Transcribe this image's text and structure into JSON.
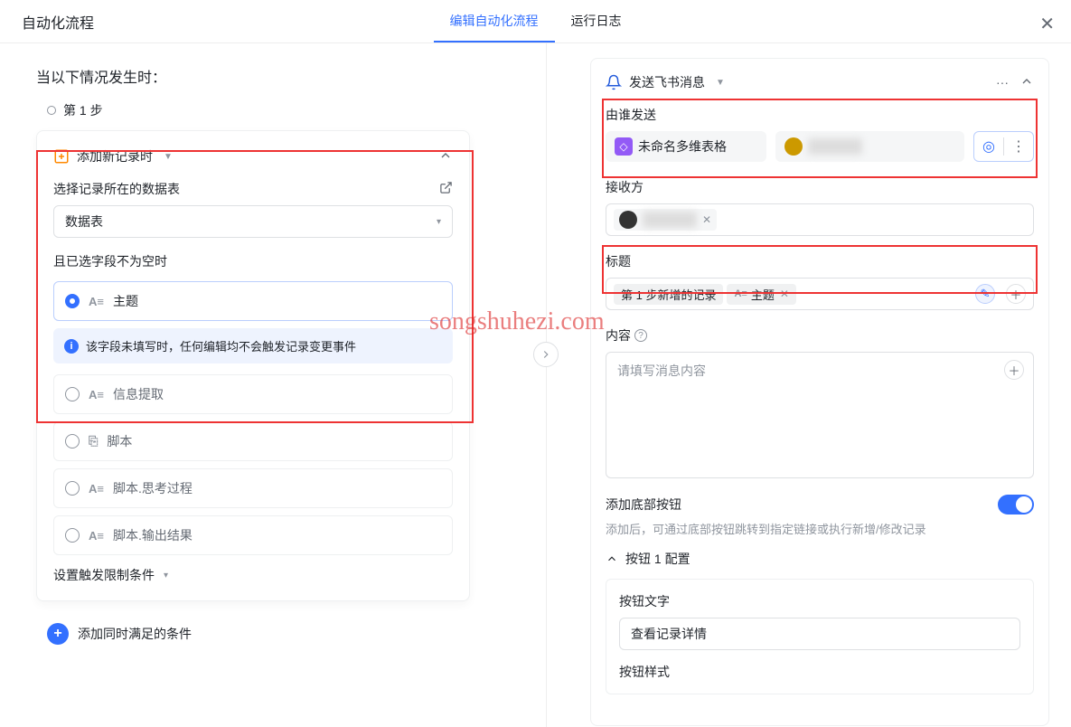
{
  "header": {
    "title": "自动化流程",
    "tabs": [
      "编辑自动化流程",
      "运行日志"
    ],
    "active_tab": 0
  },
  "left": {
    "when_title": "当以下情况发生时：",
    "step1_label": "第 1 步",
    "trigger": {
      "title": "添加新记录时",
      "select_table_label": "选择记录所在的数据表",
      "table_value": "数据表",
      "field_not_empty_label": "且已选字段不为空时",
      "info_text": "该字段未填写时，任何编辑均不会触发记录变更事件",
      "fields": {
        "option0": "主题",
        "option1": "信息提取",
        "option2": "脚本",
        "option3": "脚本.思考过程",
        "option4": "脚本.输出结果"
      },
      "set_limit": "设置触发限制条件"
    },
    "add_condition": "添加同时满足的条件"
  },
  "right": {
    "action_title": "发送飞书消息",
    "sender": {
      "label": "由谁发送",
      "doc_name": "未命名多维表格"
    },
    "receiver": {
      "label": "接收方"
    },
    "title": {
      "label": "标题",
      "chip1": "第 1 步新增的记录",
      "chip2": "主题"
    },
    "content": {
      "label": "内容",
      "placeholder": "请填写消息内容"
    },
    "bottom_btn": {
      "label": "添加底部按钮",
      "hint": "添加后，可通过底部按钮跳转到指定链接或执行新增/修改记录"
    },
    "button1": {
      "header": "按钮 1 配置",
      "text_label": "按钮文字",
      "text_value": "查看记录详情",
      "style_label": "按钮样式"
    }
  },
  "watermark": "songshuhezi.com"
}
